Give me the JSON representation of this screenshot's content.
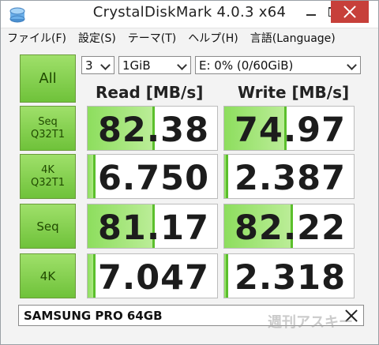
{
  "window": {
    "title": "CrystalDiskMark 4.0.3 x64",
    "controls": {
      "minimize": "minimize",
      "maximize": "maximize",
      "close": "close"
    }
  },
  "menu": {
    "items": [
      "ファイル(F)",
      "設定(S)",
      "テーマ(T)",
      "ヘルプ(H)",
      "言語(Language)"
    ]
  },
  "controls": {
    "all_label": "All",
    "count": "3",
    "size": "1GiB",
    "drive": "E: 0% (0/60GiB)"
  },
  "headers": {
    "read": "Read [MB/s]",
    "write": "Write [MB/s]"
  },
  "rows": [
    {
      "label_line1": "Seq",
      "label_line2": "Q32T1",
      "read": "82.38",
      "write": "74.97",
      "read_fill": 0.52,
      "write_fill": 0.48
    },
    {
      "label_line1": "4K",
      "label_line2": "Q32T1",
      "read": "6.750",
      "write": "2.387",
      "read_fill": 0.06,
      "write_fill": 0.03
    },
    {
      "label_line1": "Seq",
      "label_line2": "",
      "read": "81.17",
      "write": "82.22",
      "read_fill": 0.52,
      "write_fill": 0.53
    },
    {
      "label_line1": "4K",
      "label_line2": "",
      "read": "7.047",
      "write": "2.318",
      "read_fill": 0.06,
      "write_fill": 0.03
    }
  ],
  "comment": {
    "value": "SAMSUNG PRO 64GB"
  },
  "watermark": "週刊アスキー",
  "colors": {
    "accent_green": "#6fc23a",
    "close_red": "#c7403a"
  },
  "icons": {
    "app": "crystaldiskmark-icon",
    "clear": "close-icon"
  }
}
